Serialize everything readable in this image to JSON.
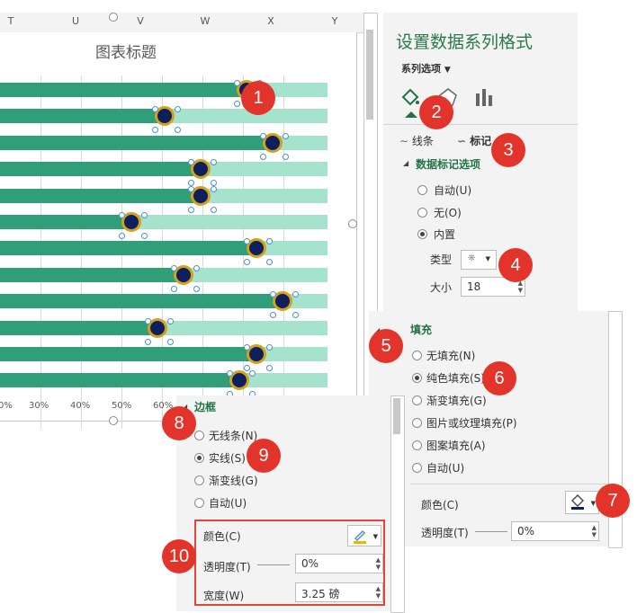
{
  "sheet": {
    "columns": [
      "T",
      "U",
      "V",
      "W",
      "X",
      "Y"
    ]
  },
  "chart": {
    "title": "图表标题",
    "x_ticks": [
      "0%",
      "30%",
      "40%",
      "50%",
      "60%"
    ]
  },
  "chart_data": {
    "type": "bar",
    "title": "图表标题",
    "series": [
      {
        "values": [
          0.76,
          0.51,
          0.84,
          0.62,
          0.62,
          0.41,
          0.79,
          0.57,
          0.87,
          0.49,
          0.79,
          0.74
        ]
      },
      {
        "values": [
          1,
          1,
          1,
          1,
          1,
          1,
          1,
          1,
          1,
          1,
          1,
          1
        ]
      }
    ],
    "colors": {
      "fill": "#2f9e79",
      "background": "#a6e3cc",
      "marker": "#0d1f5c",
      "marker_border": "#d4a11d"
    }
  },
  "format_panel": {
    "title": "设置数据系列格式",
    "series_options": "系列选项",
    "tabs": {
      "line": "线条",
      "marker": "标记"
    },
    "marker_options_section": "数据标记选项",
    "marker_radio": [
      "自动(U)",
      "无(O)",
      "内置"
    ],
    "type_label": "类型",
    "size_label": "大小",
    "size_value": "18"
  },
  "fill_panel": {
    "section": "填充",
    "options": [
      "无填充(N)",
      "纯色填充(S)",
      "渐变填充(G)",
      "图片或纹理填充(P)",
      "图案填充(A)",
      "自动(U)"
    ],
    "color_label": "颜色(C)",
    "transparency_label": "透明度(T)",
    "transparency_value": "0%"
  },
  "border_panel": {
    "section": "边框",
    "options": [
      "无线条(N)",
      "实线(S)",
      "渐变线(G)",
      "自动(U)"
    ],
    "color_label": "颜色(C)",
    "transparency_label": "透明度(T)",
    "transparency_value": "0%",
    "width_label": "宽度(W)",
    "width_value": "3.25 磅"
  },
  "badges": [
    "1",
    "2",
    "3",
    "4",
    "5",
    "6",
    "7",
    "8",
    "9",
    "10"
  ],
  "colors": {
    "badge": "#e3342c",
    "accent": "#217346",
    "highlight": "#e0443a"
  }
}
